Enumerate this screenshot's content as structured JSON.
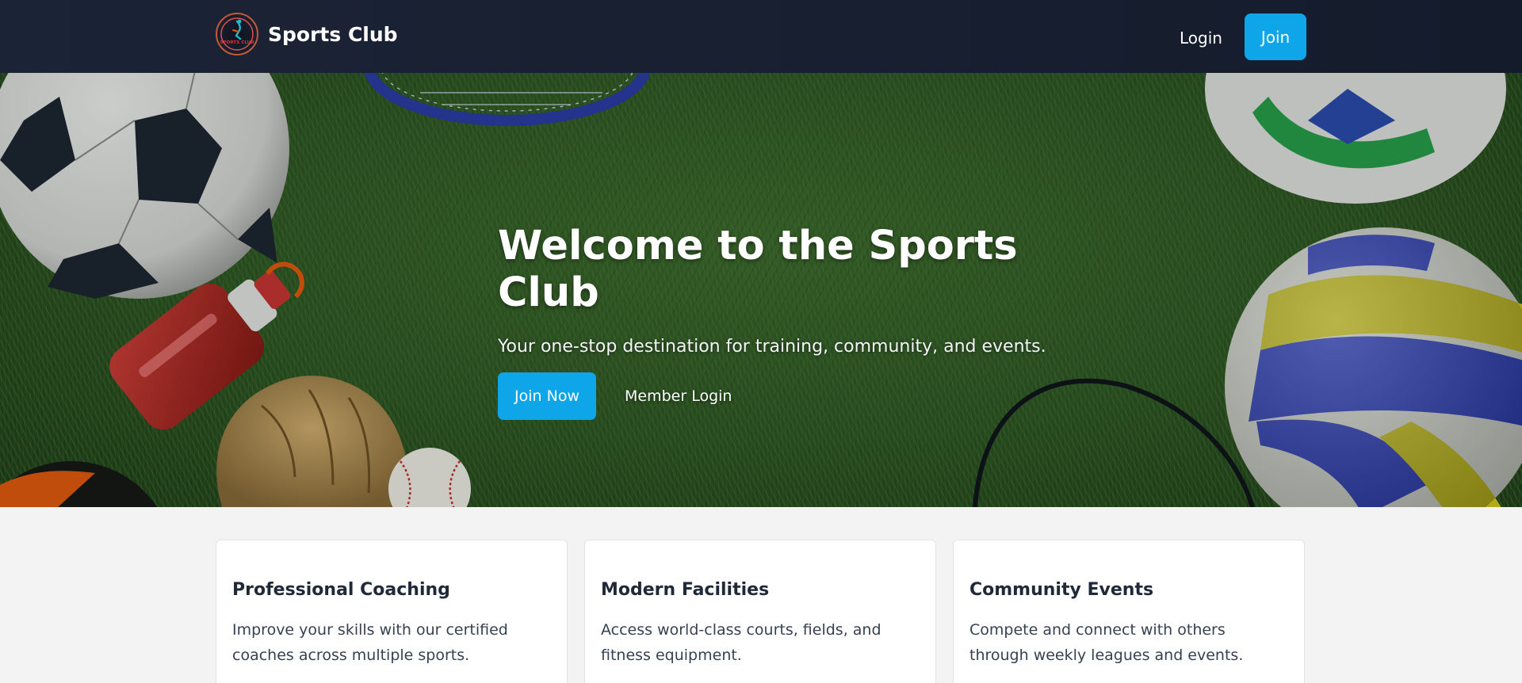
{
  "navbar": {
    "brand_name": "Sports Club",
    "logo_text": "SPORTS CLUB",
    "login_label": "Login",
    "join_label": "Join"
  },
  "hero": {
    "title": "Welcome to the Sports Club",
    "subtitle": "Your one-stop destination for training, community, and events.",
    "join_now_label": "Join Now",
    "member_login_label": "Member Login"
  },
  "features": [
    {
      "title": "Professional Coaching",
      "text": "Improve your skills with our certified coaches across multiple sports."
    },
    {
      "title": "Modern Facilities",
      "text": "Access world-class courts, fields, and fitness equipment."
    },
    {
      "title": "Community Events",
      "text": "Compete and connect with others through weekly leagues and events."
    }
  ],
  "colors": {
    "navbar_bg": "#1b2336",
    "accent": "#0ea5e9",
    "page_bg": "#f3f3f3"
  }
}
